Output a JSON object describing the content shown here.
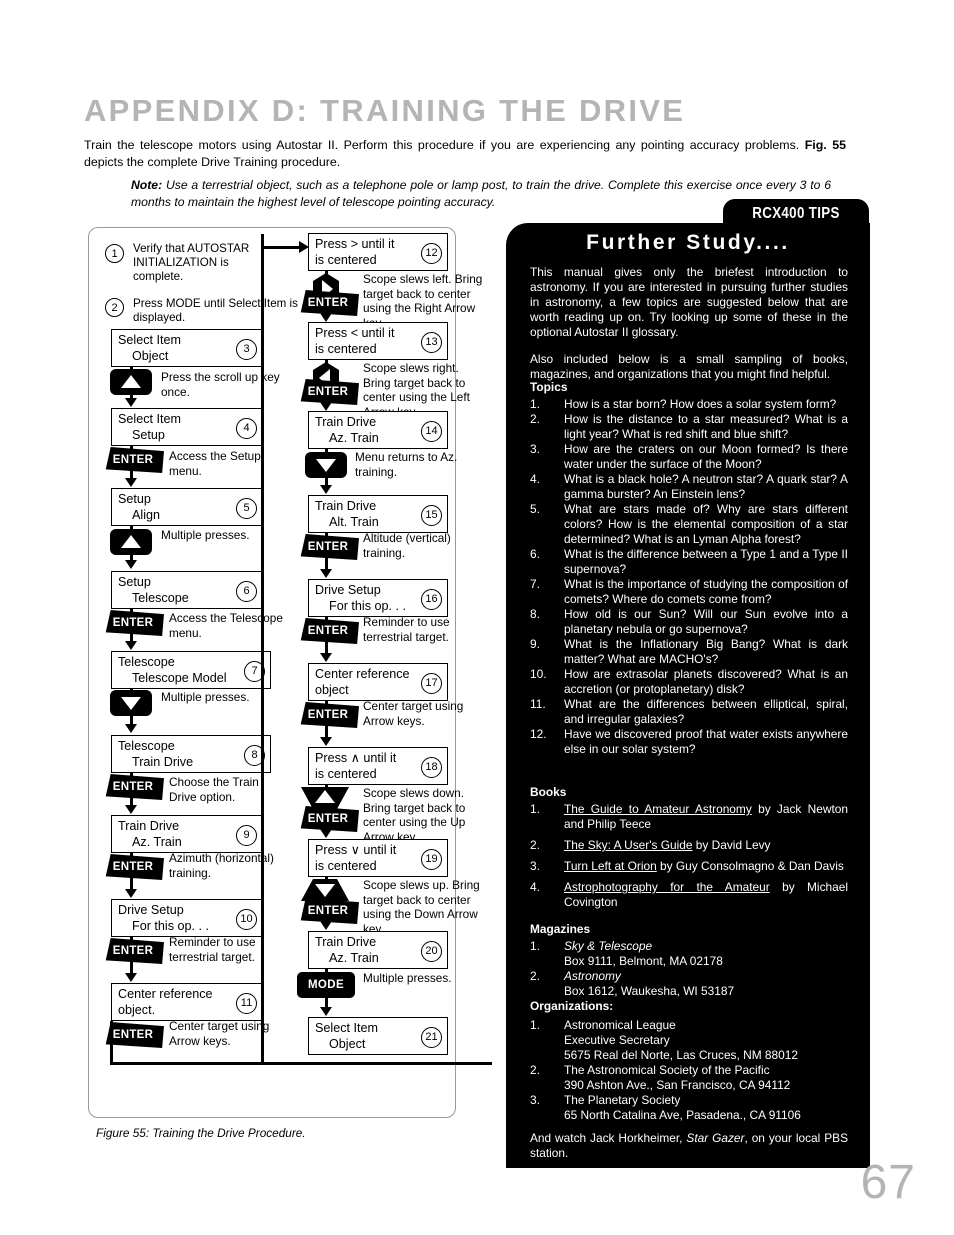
{
  "header": {
    "title": "APPENDIX D: TRAINING THE DRIVE",
    "intro_a": "Train the telescope motors using Autostar II. Perform this procedure if you are experiencing any pointing accuracy problems. ",
    "intro_bold": "Fig. 55",
    "intro_b": " depicts the complete Drive Training procedure.",
    "note_label": "Note:",
    "note_text": " Use a terrestrial object, such as a telephone pole or lamp post, to train the drive. Complete this exercise once every 3 to 6 months to maintain the highest level of telescope pointing accuracy."
  },
  "figure": {
    "caption": "Figure 55: Training the Drive Procedure.",
    "steps": [
      {
        "n": "1",
        "type": "text",
        "text": "Verify that AUTOSTAR INITIALIZATION is complete."
      },
      {
        "n": "2",
        "type": "text",
        "text": "Press MODE until Select Item is displayed."
      },
      {
        "n": "3",
        "type": "lcd",
        "line1": "Select Item",
        "line2": "Object",
        "key": "scroll-up",
        "note": "Press the scroll up key once."
      },
      {
        "n": "4",
        "type": "lcd",
        "line1": "Select Item",
        "line2": "Setup",
        "key": "enter",
        "note": "Access the Setup menu."
      },
      {
        "n": "5",
        "type": "lcd",
        "line1": "Setup",
        "line2": "Align",
        "key": "scroll-up",
        "note": "Multiple presses."
      },
      {
        "n": "6",
        "type": "lcd",
        "line1": "Setup",
        "line2": "Telescope",
        "key": "enter",
        "note": "Access the Telescope menu."
      },
      {
        "n": "7",
        "type": "lcd",
        "line1": "Telescope",
        "line2": "Telescope Model",
        "key": "scroll-down",
        "note": "Multiple presses."
      },
      {
        "n": "8",
        "type": "lcd",
        "line1": "Telescope",
        "line2": "Train Drive",
        "key": "enter",
        "note": "Choose the Train Drive option."
      },
      {
        "n": "9",
        "type": "lcd",
        "line1": "Train Drive",
        "line2": "Az. Train",
        "key": "enter",
        "note": "Azimuth (horizontal) training."
      },
      {
        "n": "10",
        "type": "lcd",
        "line1": "Drive Setup",
        "line2": "For this op. . .",
        "key": "enter",
        "note": "Reminder to use terrestrial target."
      },
      {
        "n": "11",
        "type": "lcd",
        "line1": "Center reference",
        "line2": "object.",
        "key": "enter",
        "note": "Center target using Arrow keys."
      },
      {
        "n": "12",
        "type": "lcd",
        "line1": "Press  >  until it",
        "line2": "is centered",
        "key": "right-arrow+enter",
        "note": "Scope slews left. Bring target back to center using the Right Arrow key."
      },
      {
        "n": "13",
        "type": "lcd",
        "line1": "Press  <  until it",
        "line2": "is centered",
        "key": "left-arrow+enter",
        "note": "Scope slews right. Bring target back to center using the Left Arrow key."
      },
      {
        "n": "14",
        "type": "lcd",
        "line1": "Train Drive",
        "line2": "Az. Train",
        "key": "scroll-down",
        "note": "Menu returns to Az. training."
      },
      {
        "n": "15",
        "type": "lcd",
        "line1": "Train Drive",
        "line2": "Alt. Train",
        "key": "enter",
        "note": "Altitude (vertical) training."
      },
      {
        "n": "16",
        "type": "lcd",
        "line1": "Drive Setup",
        "line2": "For this op. . .",
        "key": "enter",
        "note": "Reminder to use terrestrial target."
      },
      {
        "n": "17",
        "type": "lcd",
        "line1": "Center reference",
        "line2": "object",
        "key": "enter",
        "note": "Center target using Arrow keys."
      },
      {
        "n": "18",
        "type": "lcd",
        "line1": "Press ∧ until it",
        "line2": "is centered",
        "key": "up-arrow+enter",
        "note": "Scope slews down. Bring target back to center using the Up Arrow key."
      },
      {
        "n": "19",
        "type": "lcd",
        "line1": "Press ∨ until it",
        "line2": "is centered",
        "key": "down-arrow+enter",
        "note": "Scope slews up. Bring target back to center using the Down Arrow key."
      },
      {
        "n": "20",
        "type": "lcd",
        "line1": "Train Drive",
        "line2": "Az. Train",
        "key": "mode",
        "note": "Multiple presses."
      },
      {
        "n": "21",
        "type": "lcd",
        "line1": "Select Item",
        "line2": "Object",
        "key": "",
        "note": ""
      }
    ],
    "key_labels": {
      "enter": "ENTER",
      "mode": "MODE"
    }
  },
  "tips": {
    "tab_label": "RCX400 TIPS",
    "title": "Further Study....",
    "para1": "This manual gives only the briefest introduction to astronomy. If you are interested in pursuing further studies in astronomy, a few topics are suggested below that are worth reading up on. Try looking up some of these in the optional Autostar II glossary.",
    "para2": "Also included below is a small sampling of books, magazines, and organizations that you might find helpful.",
    "topics_head": "Topics",
    "topics": [
      "How is a star born? How does a solar system form?",
      "How is the distance to a star measured? What is a light year? What is red shift and blue shift?",
      "How are the craters on our Moon formed? Is there water under the surface of the Moon?",
      "What is a black hole? A neutron star? A quark star? A gamma burster? An Einstein lens?",
      "What are stars made of? Why are stars different colors? How is the elemental composition of a star determined? What is an Lyman Alpha forest?",
      "What is the difference between a Type 1 and a Type II supernova?",
      "What is the importance of studying the composition of comets? Where do comets come from?",
      "How old is our Sun? Will our Sun evolve into a planetary nebula or go supernova?",
      "What is the Inflationary Big Bang? What is dark matter? What are MACHO's?",
      "How are extrasolar planets discovered? What is an accretion (or protoplanetary) disk?",
      "What are the differences between elliptical, spiral, and irregular galaxies?",
      "Have we discovered proof that water exists anywhere else in our solar system?"
    ],
    "books_head": "Books",
    "books": [
      {
        "title": "The Guide to Amateur Astronomy",
        "rest": " by Jack Newton and Philip Teece"
      },
      {
        "title": "The Sky: A User's Guide",
        "rest": " by David Levy"
      },
      {
        "title": "Turn Left at Orion",
        "rest": " by Guy Consolmagno & Dan Davis"
      },
      {
        "title": "Astrophotography for the Amateur",
        "rest": " by Michael Covington"
      }
    ],
    "magazines_head": "Magazines",
    "magazines": [
      {
        "name": "Sky & Telescope",
        "addr": "Box 9111, Belmont, MA 02178"
      },
      {
        "name": "Astronomy",
        "addr": "Box 1612, Waukesha, WI 53187"
      }
    ],
    "organizations_head": "Organizations:",
    "organizations": [
      {
        "l1": "Astronomical League",
        "l2": "Executive Secretary",
        "l3": "5675 Real del Norte, Las Cruces, NM 88012"
      },
      {
        "l1": "The Astronomical Society of the Pacific",
        "l2": "390 Ashton Ave., San Francisco, CA 94112",
        "l3": ""
      },
      {
        "l1": "The Planetary Society",
        "l2": "65 North Catalina Ave, Pasadena., CA 91106",
        "l3": ""
      }
    ],
    "closing_a": "And watch Jack Horkheimer, ",
    "closing_i": "Star Gazer",
    "closing_b": ", on your local PBS station."
  },
  "page_number": "67"
}
